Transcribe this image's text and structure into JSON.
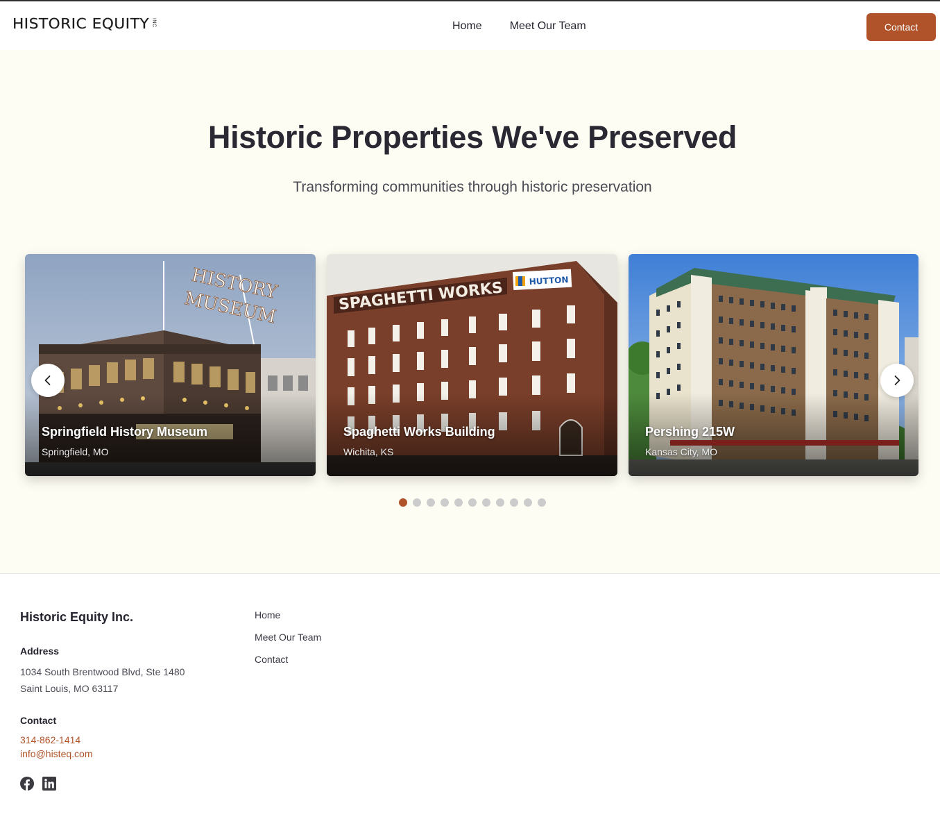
{
  "header": {
    "logo_text": "HISTORIC EQUITY",
    "logo_suffix": "INC",
    "nav": [
      {
        "label": "Home"
      },
      {
        "label": "Meet Our Team"
      }
    ],
    "contact_label": "Contact"
  },
  "hero": {
    "title": "Historic Properties We've Preserved",
    "subtitle": "Transforming communities through historic preservation"
  },
  "carousel": {
    "cards": [
      {
        "title": "Springfield History Museum",
        "location": "Springfield, MO"
      },
      {
        "title": "Spaghetti Works Building",
        "location": "Wichita, KS"
      },
      {
        "title": "Pershing 215W",
        "location": "Kansas City, MO"
      }
    ],
    "sign_texts": {
      "museum": "HISTORY MUSEUM",
      "spaghetti": "SPAGHETTI WORKS",
      "hutton": "HUTTON"
    },
    "dot_count": 11,
    "active_dot": 1,
    "prev_icon": "chevron-left-icon",
    "next_icon": "chevron-right-icon"
  },
  "footer": {
    "company": "Historic Equity Inc.",
    "address_heading": "Address",
    "address_line1": "1034 South Brentwood Blvd, Ste 1480",
    "address_line2": "Saint Louis, MO 63117",
    "contact_heading": "Contact",
    "phone": "314-862-1414",
    "email": "info@histeq.com",
    "nav": [
      {
        "label": "Home"
      },
      {
        "label": "Meet Our Team"
      },
      {
        "label": "Contact"
      }
    ],
    "social_icons": [
      "facebook-icon",
      "linkedin-icon"
    ]
  },
  "colors": {
    "accent": "#b0522a",
    "hero_bg": "#fefdf3",
    "dot_inactive": "#cccccc"
  }
}
